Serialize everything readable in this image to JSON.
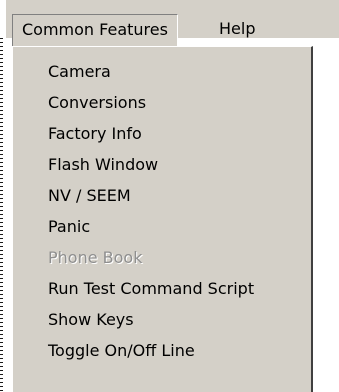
{
  "menubar": {
    "items": [
      {
        "label": "Common Features"
      },
      {
        "label": "Help"
      }
    ]
  },
  "dropdown": {
    "items": [
      {
        "label": "Camera",
        "enabled": true
      },
      {
        "label": "Conversions",
        "enabled": true
      },
      {
        "label": "Factory Info",
        "enabled": true
      },
      {
        "label": "Flash Window",
        "enabled": true
      },
      {
        "label": "NV / SEEM",
        "enabled": true
      },
      {
        "label": "Panic",
        "enabled": true
      },
      {
        "label": "Phone Book",
        "enabled": false
      },
      {
        "label": "Run Test Command Script",
        "enabled": true
      },
      {
        "label": "Show Keys",
        "enabled": true
      },
      {
        "label": "Toggle On/Off Line",
        "enabled": true
      }
    ]
  },
  "colors": {
    "menu_background": "#d4d0c8",
    "disabled_text": "#8f8f8f",
    "text": "#000000"
  }
}
